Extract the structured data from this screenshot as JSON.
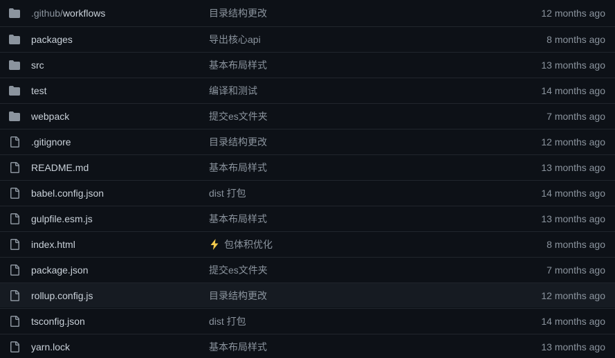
{
  "rows": [
    {
      "name_prefix": ".github/",
      "name": "workflows",
      "type": "folder",
      "message": "目录结构更改",
      "emoji": "",
      "age": "12 months ago"
    },
    {
      "name_prefix": "",
      "name": "packages",
      "type": "folder",
      "message": "导出核心api",
      "emoji": "",
      "age": "8 months ago"
    },
    {
      "name_prefix": "",
      "name": "src",
      "type": "folder",
      "message": "基本布局样式",
      "emoji": "",
      "age": "13 months ago"
    },
    {
      "name_prefix": "",
      "name": "test",
      "type": "folder",
      "message": "编译和测试",
      "emoji": "",
      "age": "14 months ago"
    },
    {
      "name_prefix": "",
      "name": "webpack",
      "type": "folder",
      "message": "提交es文件夹",
      "emoji": "",
      "age": "7 months ago"
    },
    {
      "name_prefix": "",
      "name": ".gitignore",
      "type": "file",
      "message": "目录结构更改",
      "emoji": "",
      "age": "12 months ago"
    },
    {
      "name_prefix": "",
      "name": "README.md",
      "type": "file",
      "message": "基本布局样式",
      "emoji": "",
      "age": "13 months ago"
    },
    {
      "name_prefix": "",
      "name": "babel.config.json",
      "type": "file",
      "message": "dist 打包",
      "emoji": "",
      "age": "14 months ago"
    },
    {
      "name_prefix": "",
      "name": "gulpfile.esm.js",
      "type": "file",
      "message": "基本布局样式",
      "emoji": "",
      "age": "13 months ago"
    },
    {
      "name_prefix": "",
      "name": "index.html",
      "type": "file",
      "message": "包体积优化",
      "emoji": "zap",
      "age": "8 months ago"
    },
    {
      "name_prefix": "",
      "name": "package.json",
      "type": "file",
      "message": "提交es文件夹",
      "emoji": "",
      "age": "7 months ago"
    },
    {
      "name_prefix": "",
      "name": "rollup.config.js",
      "type": "file",
      "message": "目录结构更改",
      "emoji": "",
      "age": "12 months ago"
    },
    {
      "name_prefix": "",
      "name": "tsconfig.json",
      "type": "file",
      "message": "dist 打包",
      "emoji": "",
      "age": "14 months ago"
    },
    {
      "name_prefix": "",
      "name": "yarn.lock",
      "type": "file",
      "message": "基本布局样式",
      "emoji": "",
      "age": "13 months ago"
    }
  ],
  "highlighted_row_name": "rollup.config.js",
  "colors": {
    "background": "#0d1117",
    "row_hover": "#161b22",
    "border": "#21262d",
    "text_primary": "#c9d1d9",
    "text_secondary": "#8b949e",
    "folder_icon": "#8b949e",
    "zap_emoji": "#f2c94c"
  }
}
